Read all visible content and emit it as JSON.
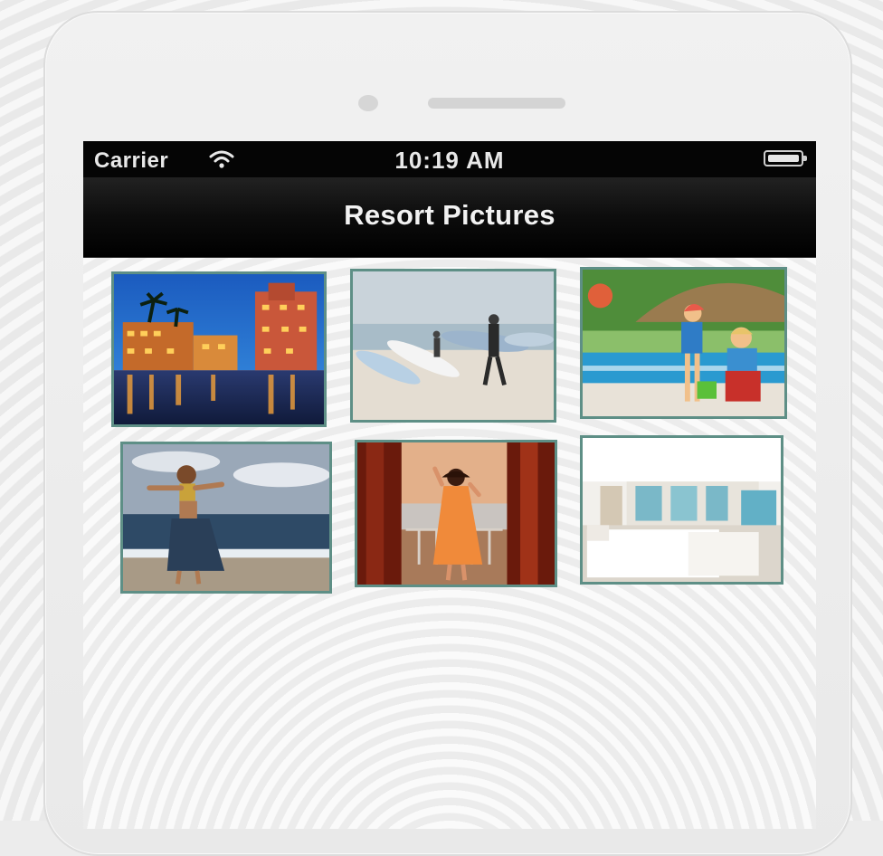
{
  "status_bar": {
    "carrier": "Carrier",
    "time": "10:19 AM",
    "wifi_icon": "wifi-icon",
    "battery_icon": "battery-icon"
  },
  "nav_bar": {
    "title": "Resort Pictures"
  },
  "gallery": {
    "photos": [
      {
        "subject": "resort-night-photo"
      },
      {
        "subject": "surfers-beach-photo"
      },
      {
        "subject": "children-pool-photo"
      },
      {
        "subject": "hula-dancer-beach-photo"
      },
      {
        "subject": "woman-balcony-photo"
      },
      {
        "subject": "hotel-bedroom-photo"
      }
    ]
  },
  "colors": {
    "thumb_border": "#5e8f86",
    "bar_background": "#050505",
    "bar_text": "#f2f2f2"
  }
}
